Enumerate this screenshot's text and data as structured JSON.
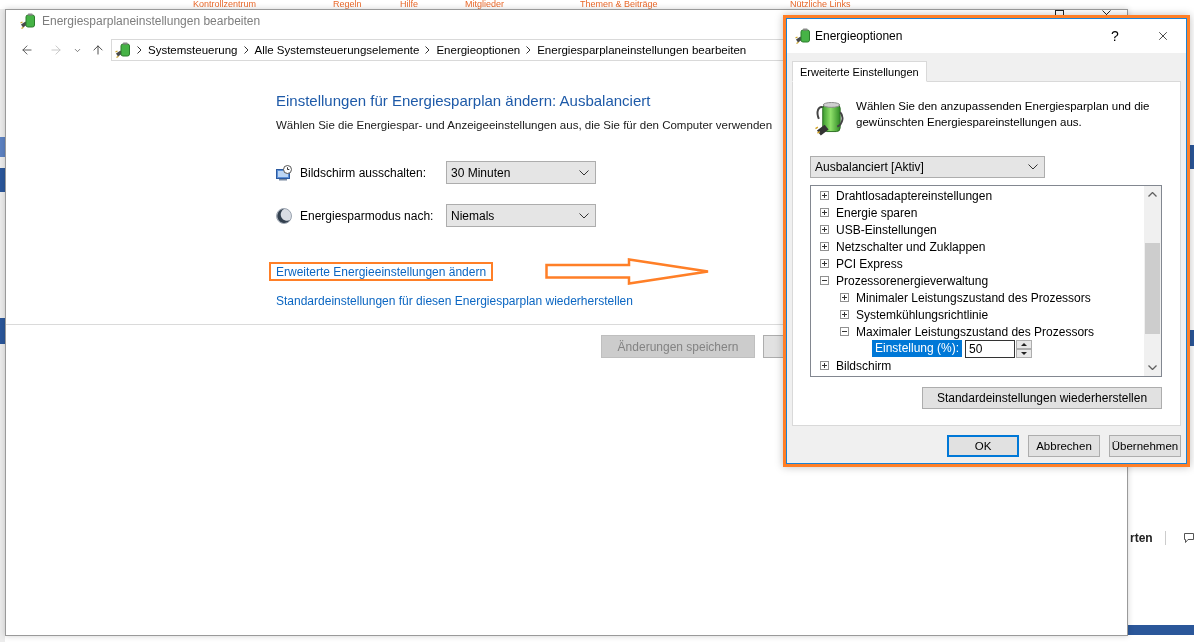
{
  "background_page": {
    "nav_links": [
      "Kontrollzentrum",
      "Regeln",
      "Hilfe",
      "Mitglieder",
      "Themen & Beiträge",
      "Nützliche Links"
    ],
    "side_text": "rten"
  },
  "window": {
    "title": "Energiesparplaneinstellungen bearbeiten",
    "breadcrumb": [
      "Systemsteuerung",
      "Alle Systemsteuerungselemente",
      "Energieoptionen",
      "Energiesparplaneinstellungen bearbeiten"
    ]
  },
  "content": {
    "heading": "Einstellungen für Energiesparplan ändern: Ausbalanciert",
    "description": "Wählen Sie die Energiespar- und Anzeigeeinstellungen aus, die Sie für den Computer verwenden",
    "settings": [
      {
        "kind": "display",
        "label": "Bildschirm ausschalten:",
        "value": "30 Minuten"
      },
      {
        "kind": "sleep",
        "label": "Energiesparmodus nach:",
        "value": "Niemals"
      }
    ],
    "links": [
      {
        "label": "Erweiterte Energieeinstellungen ändern",
        "highlighted": true
      },
      {
        "label": "Standardeinstellungen für diesen Energiesparplan wiederherstellen",
        "highlighted": false
      }
    ],
    "buttons": [
      {
        "label": "Änderungen speichern",
        "disabled": true
      }
    ]
  },
  "dialog": {
    "title": "Energieoptionen",
    "help_glyph": "?",
    "highlighted": true,
    "tabs": [
      {
        "label": "Erweiterte Einstellungen",
        "selected": true
      }
    ],
    "intro": "Wählen Sie den anzupassenden Energiesparplan und die gewünschten Energiespareinstellungen aus.",
    "plan": "Ausbalanciert [Aktiv]",
    "tree": [
      {
        "kind": "group",
        "label": "Drahtlosadaptereinstellungen",
        "expanded": false
      },
      {
        "kind": "group",
        "label": "Energie sparen",
        "expanded": false
      },
      {
        "kind": "group",
        "label": "USB-Einstellungen",
        "expanded": false
      },
      {
        "kind": "group",
        "label": "Netzschalter und Zuklappen",
        "expanded": false
      },
      {
        "kind": "group",
        "label": "PCI Express",
        "expanded": false
      },
      {
        "kind": "group",
        "label": "Prozessorenergieverwaltung",
        "expanded": true,
        "children": [
          {
            "kind": "group",
            "label": "Minimaler Leistungszustand des Prozessors",
            "expanded": false
          },
          {
            "kind": "group",
            "label": "Systemkühlungsrichtlinie",
            "expanded": false
          },
          {
            "kind": "group",
            "label": "Maximaler Leistungszustand des Prozessors",
            "expanded": true,
            "children": [
              {
                "kind": "setting",
                "label": "Einstellung (%):",
                "value": "50",
                "selected": true
              }
            ]
          }
        ]
      },
      {
        "kind": "group",
        "label": "Bildschirm",
        "expanded": false
      }
    ],
    "restore_button": "Standardeinstellungen wiederherstellen",
    "buttons": [
      {
        "label": "OK",
        "default": true
      },
      {
        "label": "Abbrechen",
        "default": false
      },
      {
        "label": "Übernehmen",
        "default": false
      }
    ]
  }
}
